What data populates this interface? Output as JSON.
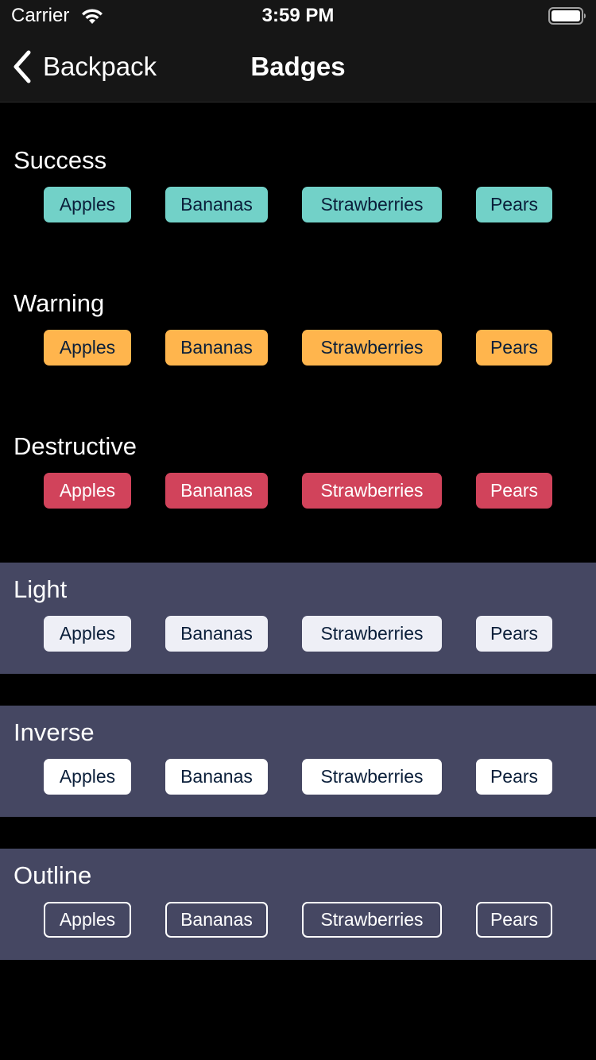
{
  "status_bar": {
    "carrier": "Carrier",
    "time": "3:59 PM",
    "wifi_icon": "wifi-icon",
    "battery_icon": "battery-icon"
  },
  "nav": {
    "back_label": "Backpack",
    "back_icon": "chevron-left-icon",
    "title": "Badges"
  },
  "sections": [
    {
      "title": "Success",
      "style": "success",
      "badges": [
        "Apples",
        "Bananas",
        "Strawberries",
        "Pears"
      ]
    },
    {
      "title": "Warning",
      "style": "warning",
      "badges": [
        "Apples",
        "Bananas",
        "Strawberries",
        "Pears"
      ]
    },
    {
      "title": "Destructive",
      "style": "destructive",
      "badges": [
        "Apples",
        "Bananas",
        "Strawberries",
        "Pears"
      ]
    },
    {
      "title": "Light",
      "style": "light",
      "badges": [
        "Apples",
        "Bananas",
        "Strawberries",
        "Pears"
      ]
    },
    {
      "title": "Inverse",
      "style": "inverse",
      "badges": [
        "Apples",
        "Bananas",
        "Strawberries",
        "Pears"
      ]
    },
    {
      "title": "Outline",
      "style": "outline",
      "badges": [
        "Apples",
        "Bananas",
        "Strawberries",
        "Pears"
      ]
    }
  ],
  "colors": {
    "background": "#000000",
    "bar_background": "#161616",
    "tinted_section": "#454762",
    "success": "#72d1c8",
    "warning": "#ffb54d",
    "destructive": "#d1435b",
    "light": "#eeeff6",
    "inverse": "#ffffff",
    "badge_text_dark": "#0b1f3a"
  }
}
